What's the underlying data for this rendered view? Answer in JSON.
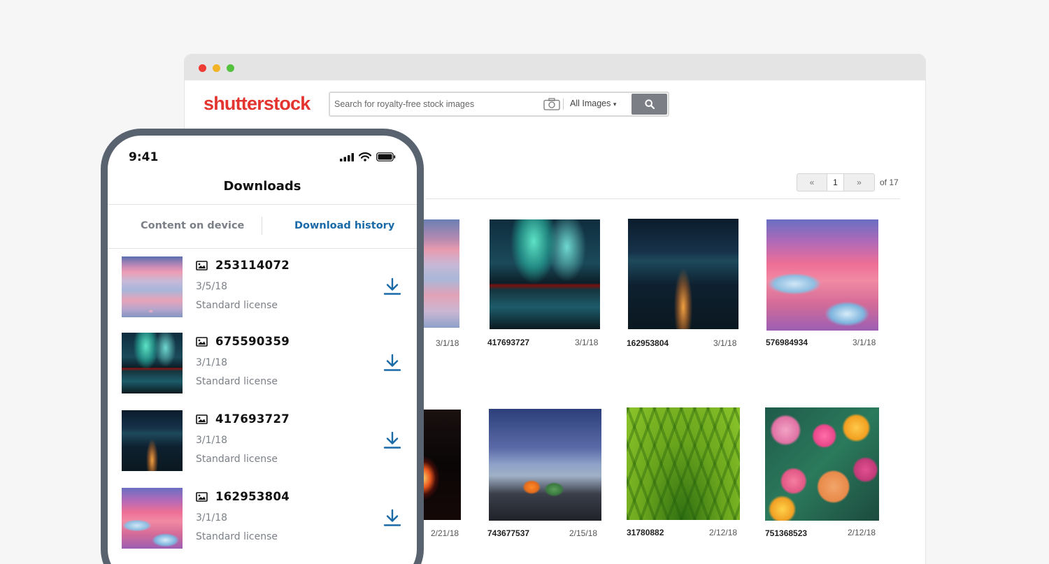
{
  "browser": {
    "logo": "shutterstock",
    "search": {
      "placeholder": "Search for royalty-free stock images",
      "filter": "All Images"
    },
    "pager": {
      "prev": "«",
      "current": "1",
      "next": "»",
      "total": "of 17"
    },
    "grid": [
      {
        "id": "",
        "date": "3/1/18"
      },
      {
        "id": "417693727",
        "date": "3/1/18"
      },
      {
        "id": "162953804",
        "date": "3/1/18"
      },
      {
        "id": "576984934",
        "date": "3/1/18"
      },
      {
        "id": "",
        "date": "2/21/18"
      },
      {
        "id": "743677537",
        "date": "2/15/18"
      },
      {
        "id": "31780882",
        "date": "2/12/18"
      },
      {
        "id": "751368523",
        "date": "2/12/18"
      }
    ]
  },
  "phone": {
    "time": "9:41",
    "title": "Downloads",
    "tabs": [
      "Content on device",
      "Download history"
    ],
    "items": [
      {
        "id": "253114072",
        "date": "3/5/18",
        "license": "Standard license"
      },
      {
        "id": "675590359",
        "date": "3/1/18",
        "license": "Standard license"
      },
      {
        "id": "417693727",
        "date": "3/1/18",
        "license": "Standard license"
      },
      {
        "id": "162953804",
        "date": "3/1/18",
        "license": "Standard license"
      }
    ]
  },
  "colors": {
    "brand": "#e3342f",
    "accent": "#1a6aa8",
    "phone_frame": "#59626f"
  },
  "icons": [
    "camera-icon",
    "search-icon",
    "image-icon",
    "download-icon",
    "signal-icon",
    "wifi-icon",
    "battery-icon"
  ]
}
